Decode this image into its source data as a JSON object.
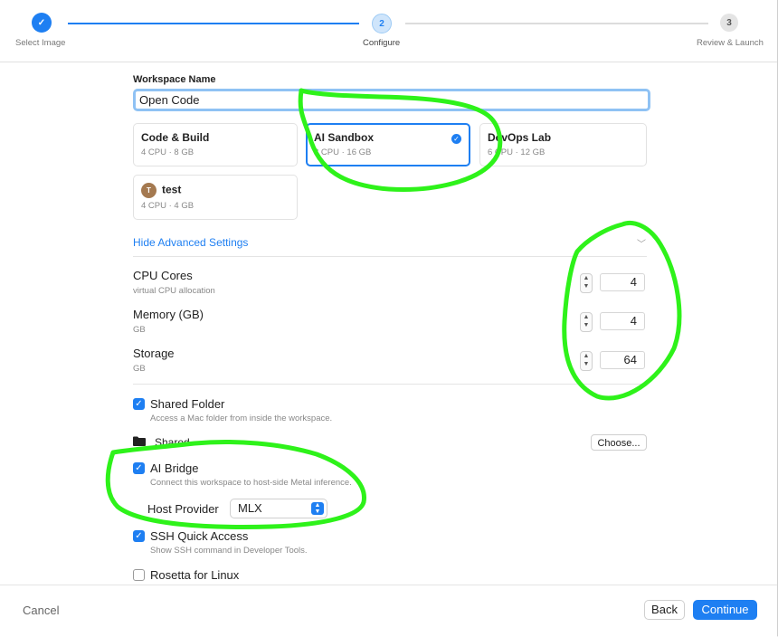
{
  "stepper": {
    "steps": [
      {
        "label": "Select Image",
        "marker": "✓"
      },
      {
        "label": "Configure",
        "marker": "2"
      },
      {
        "label": "Review & Launch",
        "marker": "3"
      }
    ]
  },
  "workspace": {
    "name_label": "Workspace Name",
    "name_value": "Open Code"
  },
  "presets": [
    {
      "title": "Code & Build",
      "sub": "4 CPU · 8 GB"
    },
    {
      "title": "AI Sandbox",
      "sub": "8 CPU · 16 GB",
      "selected": true
    },
    {
      "title": "DevOps Lab",
      "sub": "6 CPU · 12 GB"
    },
    {
      "title": "test",
      "sub": "4 CPU · 4 GB",
      "avatar": "T"
    }
  ],
  "advanced": {
    "toggle_label": "Hide Advanced Settings",
    "settings": [
      {
        "title": "CPU Cores",
        "sub": "virtual CPU allocation",
        "value": "4"
      },
      {
        "title": "Memory (GB)",
        "sub": "GB",
        "value": "4"
      },
      {
        "title": "Storage",
        "sub": "GB",
        "value": "64"
      }
    ]
  },
  "options": {
    "shared_folder": {
      "title": "Shared Folder",
      "sub": "Access a Mac folder from inside the workspace.",
      "checked": true
    },
    "folder_name": "Shared",
    "choose_label": "Choose...",
    "ai_bridge": {
      "title": "AI Bridge",
      "sub": "Connect this workspace to host-side Metal inference.",
      "checked": true
    },
    "host_provider_label": "Host Provider",
    "host_provider_value": "MLX",
    "ssh": {
      "title": "SSH Quick Access",
      "sub": "Show SSH command in Developer Tools.",
      "checked": true
    },
    "rosetta": {
      "title": "Rosetta for Linux",
      "checked": false
    }
  },
  "footer": {
    "cancel_label": "Cancel",
    "back_label": "Back",
    "continue_label": "Continue"
  },
  "colors": {
    "accent": "#1e7ff2",
    "annotation": "#2ef21a"
  }
}
